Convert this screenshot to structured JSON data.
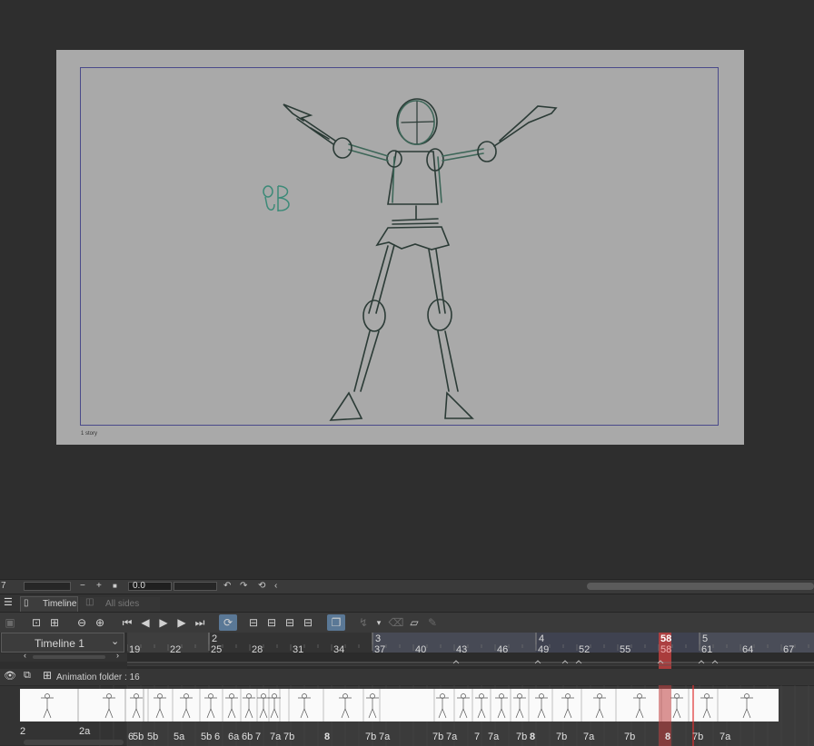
{
  "canvas": {
    "label": "1 story",
    "background": "#a9a9a9",
    "frame_color": "#4a4a8a"
  },
  "toolbar_strip": {
    "left_value": "7",
    "opacity_value": "0.0",
    "icons": [
      "minus-icon",
      "plus-icon",
      "stop-icon",
      "undo-icon",
      "redo-icon",
      "rotate-icon",
      "chevron-left-icon"
    ]
  },
  "tabs": {
    "timeline": "Timeline",
    "all_sides_view": "All sides view"
  },
  "tools": {
    "icons": [
      "new-timeline-icon",
      "frame-range-icon",
      "zoom-out-icon",
      "zoom-in-icon",
      "first-frame-icon",
      "prev-frame-icon",
      "play-icon",
      "next-frame-icon",
      "last-frame-icon",
      "loop-icon",
      "new-cel-icon",
      "specify-cel-icon",
      "specify-cel-alt-icon",
      "replace-cel-icon",
      "onion-skin-icon",
      "sync-icon",
      "dropdown-icon",
      "delete-icon",
      "edit-icon",
      "pen-icon"
    ]
  },
  "timeline": {
    "name": "Timeline 1",
    "folder_label": "Animation folder : 16",
    "accent": "#c04040",
    "current_frame": "58",
    "markers": [
      {
        "label": "2",
        "frame": 25
      },
      {
        "label": "3",
        "frame": 37
      },
      {
        "label": "4",
        "frame": 49
      },
      {
        "label": "5",
        "frame": 61
      }
    ],
    "frame_numbers": [
      "19",
      "22",
      "25",
      "28",
      "31",
      "34",
      "37",
      "40",
      "43",
      "46",
      "49",
      "52",
      "55",
      "58",
      "61",
      "64",
      "67"
    ],
    "left_cels": [
      "2",
      "2a"
    ],
    "cels": [
      "5b",
      "5b",
      "5a",
      "5b",
      "6",
      "6a",
      "6b",
      "7",
      "7a",
      "7b",
      "8",
      "7b",
      "7a",
      "7b",
      "7a",
      "7",
      "7a",
      "7b",
      "8",
      "7b",
      "7a",
      "7b",
      "8",
      "7b",
      "7a"
    ]
  }
}
